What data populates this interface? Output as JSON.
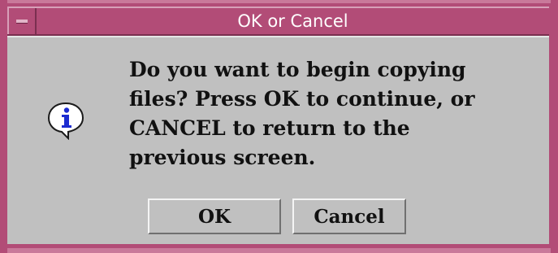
{
  "window": {
    "title": "OK or Cancel"
  },
  "dialog": {
    "icon": "info-icon",
    "message_lines": [
      "Do you want to begin copying",
      "files? Press OK to continue, or",
      "CANCEL to return to the",
      "previous screen."
    ],
    "buttons": {
      "ok_label": "OK",
      "cancel_label": "Cancel"
    }
  },
  "colors": {
    "title_bar": "#b24c77",
    "dialog_bg": "#c0c0c0",
    "icon_blue": "#1c2bd0"
  }
}
